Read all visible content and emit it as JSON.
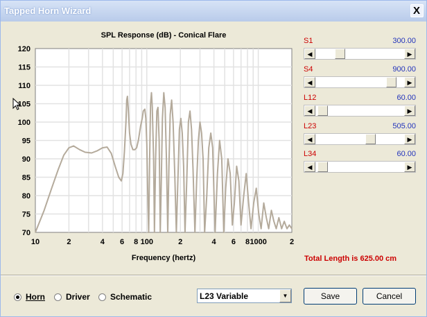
{
  "window": {
    "title": "Tapped Horn Wizard",
    "close_glyph": "X"
  },
  "chart_data": {
    "type": "line",
    "title": "SPL Response (dB) - Conical Flare",
    "xlabel": "Frequency (hertz)",
    "ylabel": "",
    "x_scale": "log",
    "xlim": [
      10,
      2000
    ],
    "ylim": [
      70,
      120
    ],
    "y_ticks": [
      70,
      75,
      80,
      85,
      90,
      95,
      100,
      105,
      110,
      115,
      120
    ],
    "x_ticks": [
      10,
      20,
      40,
      60,
      80,
      100,
      200,
      400,
      600,
      800,
      1000,
      2000
    ],
    "x_tick_labels": [
      "10",
      "2",
      "4",
      "6",
      "8",
      "100",
      "2",
      "4",
      "6",
      "8",
      "1000",
      "2"
    ],
    "grid": true,
    "series": [
      {
        "color": "#b4aa9b",
        "points": [
          [
            10,
            70
          ],
          [
            12,
            76
          ],
          [
            14,
            82
          ],
          [
            16,
            87
          ],
          [
            18,
            91
          ],
          [
            20,
            93
          ],
          [
            22,
            93.5
          ],
          [
            25,
            92.5
          ],
          [
            28,
            91.8
          ],
          [
            32,
            91.6
          ],
          [
            36,
            92.2
          ],
          [
            40,
            93
          ],
          [
            44,
            93.2
          ],
          [
            48,
            91.5
          ],
          [
            52,
            88
          ],
          [
            56,
            85
          ],
          [
            59,
            84
          ],
          [
            61,
            86
          ],
          [
            63,
            92
          ],
          [
            65,
            100
          ],
          [
            66,
            106
          ],
          [
            67,
            107
          ],
          [
            68,
            104
          ],
          [
            70,
            97
          ],
          [
            72,
            94
          ],
          [
            75,
            92.5
          ],
          [
            78,
            92.5
          ],
          [
            81,
            93
          ],
          [
            84,
            95
          ],
          [
            88,
            99
          ],
          [
            91,
            101
          ],
          [
            93,
            103
          ],
          [
            96,
            103.5
          ],
          [
            98,
            101
          ],
          [
            100,
            94
          ],
          [
            102,
            80
          ],
          [
            104,
            70
          ],
          [
            106,
            90
          ],
          [
            108,
            105
          ],
          [
            110,
            108
          ],
          [
            112,
            104
          ],
          [
            115,
            90
          ],
          [
            117,
            70
          ],
          [
            120,
            90
          ],
          [
            123,
            103
          ],
          [
            126,
            104
          ],
          [
            129,
            95
          ],
          [
            132,
            70
          ],
          [
            135,
            85
          ],
          [
            138,
            101
          ],
          [
            142,
            108
          ],
          [
            146,
            104
          ],
          [
            150,
            90
          ],
          [
            154,
            70
          ],
          [
            158,
            88
          ],
          [
            162,
            102
          ],
          [
            167,
            106
          ],
          [
            172,
            100
          ],
          [
            178,
            86
          ],
          [
            184,
            70
          ],
          [
            190,
            84
          ],
          [
            196,
            98
          ],
          [
            202,
            101
          ],
          [
            208,
            97
          ],
          [
            214,
            88
          ],
          [
            220,
            70
          ],
          [
            228,
            84
          ],
          [
            236,
            100
          ],
          [
            244,
            103
          ],
          [
            252,
            98
          ],
          [
            260,
            87
          ],
          [
            270,
            70
          ],
          [
            280,
            84
          ],
          [
            290,
            95
          ],
          [
            300,
            100
          ],
          [
            310,
            97
          ],
          [
            320,
            90
          ],
          [
            330,
            70
          ],
          [
            345,
            80
          ],
          [
            360,
            93
          ],
          [
            375,
            97
          ],
          [
            390,
            93
          ],
          [
            410,
            70
          ],
          [
            430,
            86
          ],
          [
            450,
            95
          ],
          [
            470,
            90
          ],
          [
            490,
            70
          ],
          [
            510,
            82
          ],
          [
            535,
            90
          ],
          [
            560,
            86
          ],
          [
            585,
            72
          ],
          [
            610,
            78
          ],
          [
            640,
            88
          ],
          [
            670,
            84
          ],
          [
            700,
            72
          ],
          [
            740,
            80
          ],
          [
            780,
            86
          ],
          [
            820,
            78
          ],
          [
            860,
            71
          ],
          [
            910,
            78
          ],
          [
            960,
            82
          ],
          [
            1010,
            75
          ],
          [
            1060,
            71
          ],
          [
            1120,
            78
          ],
          [
            1180,
            74
          ],
          [
            1240,
            71
          ],
          [
            1310,
            76
          ],
          [
            1380,
            73
          ],
          [
            1450,
            71
          ],
          [
            1530,
            74
          ],
          [
            1620,
            71
          ],
          [
            1710,
            73
          ],
          [
            1810,
            71
          ],
          [
            1900,
            72
          ],
          [
            2000,
            71
          ]
        ]
      }
    ]
  },
  "sliders": [
    {
      "label": "S1",
      "value": "300.00",
      "level": 0.25
    },
    {
      "label": "S4",
      "value": "900.00",
      "level": 0.9
    },
    {
      "label": "L12",
      "value": "60.00",
      "level": 0.03
    },
    {
      "label": "L23",
      "value": "505.00",
      "level": 0.64
    },
    {
      "label": "L34",
      "value": "60.00",
      "level": 0.03
    }
  ],
  "total_length": "Total Length is 625.00 cm",
  "view_options": [
    {
      "label": "Horn",
      "selected": true
    },
    {
      "label": "Driver",
      "selected": false
    },
    {
      "label": "Schematic",
      "selected": false
    }
  ],
  "mode_select": {
    "value": "L23 Variable"
  },
  "buttons": {
    "save": "Save",
    "cancel": "Cancel"
  }
}
